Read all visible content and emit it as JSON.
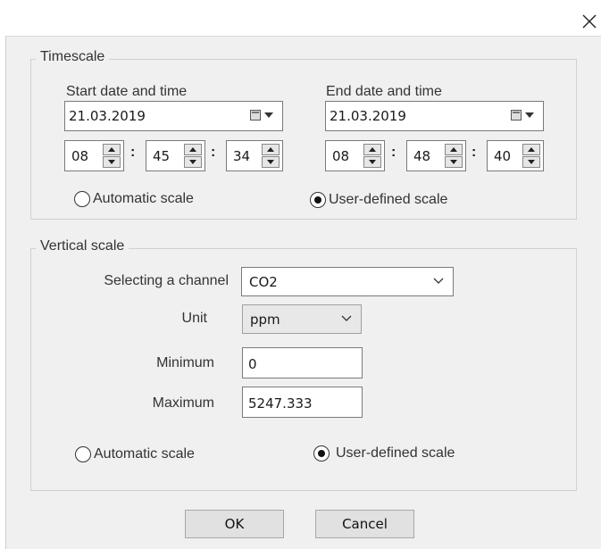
{
  "window": {
    "close_icon": "close-icon"
  },
  "timescale": {
    "legend": "Timescale",
    "start": {
      "label": "Start date and time",
      "date": "21.03.2019",
      "hour": "08",
      "minute": "45",
      "second": "34"
    },
    "end": {
      "label": "End date and time",
      "date": "21.03.2019",
      "hour": "08",
      "minute": "48",
      "second": "40"
    },
    "separator": ":",
    "radio_auto": {
      "label": "Automatic scale",
      "checked": false
    },
    "radio_user": {
      "label": "User-defined scale",
      "checked": true
    }
  },
  "vertical": {
    "legend": "Vertical scale",
    "channel_label": "Selecting a channel",
    "channel_value": "CO2",
    "unit_label": "Unit",
    "unit_value": "ppm",
    "minimum_label": "Minimum",
    "minimum_value": "0",
    "maximum_label": "Maximum",
    "maximum_value": "5247.333",
    "radio_auto": {
      "label": "Automatic scale",
      "checked": false
    },
    "radio_user": {
      "label": "User-defined scale",
      "checked": true
    }
  },
  "buttons": {
    "ok": "OK",
    "cancel": "Cancel"
  }
}
